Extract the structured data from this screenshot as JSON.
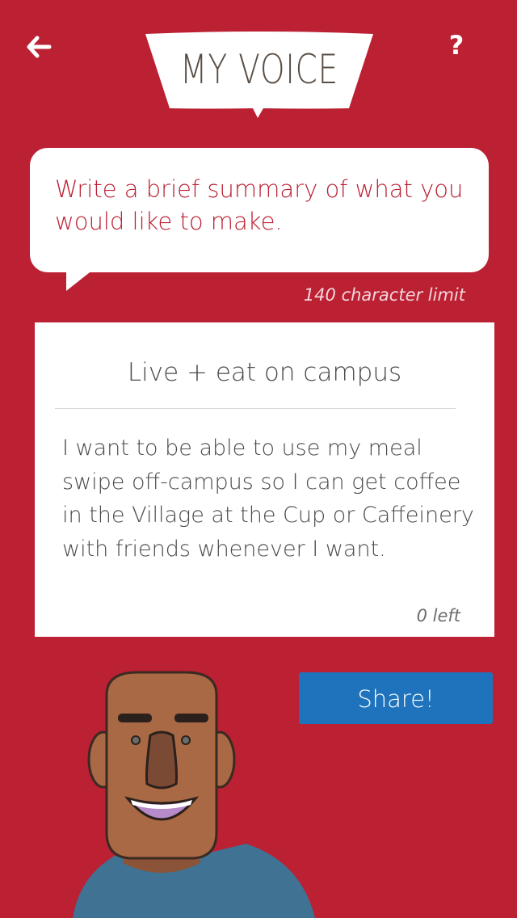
{
  "header": {
    "title": "MY VOICE",
    "help_label": "?",
    "back_icon": "arrow-left-icon"
  },
  "prompt": {
    "text": "Write a brief summary of what you would like to make.",
    "char_limit": "140 character limit"
  },
  "entry": {
    "title": "Live + eat on campus",
    "body": "I want to be able to use my meal swipe off-campus so I can get coffee in the Village at the Cup or Caffeinery with friends whenever I want.",
    "chars_left": "0 left"
  },
  "actions": {
    "share_label": "Share!"
  },
  "colors": {
    "background": "#bb2033",
    "prompt_text": "#bb2033",
    "share_button": "#1f73bd",
    "title_text": "#5a4e44"
  }
}
